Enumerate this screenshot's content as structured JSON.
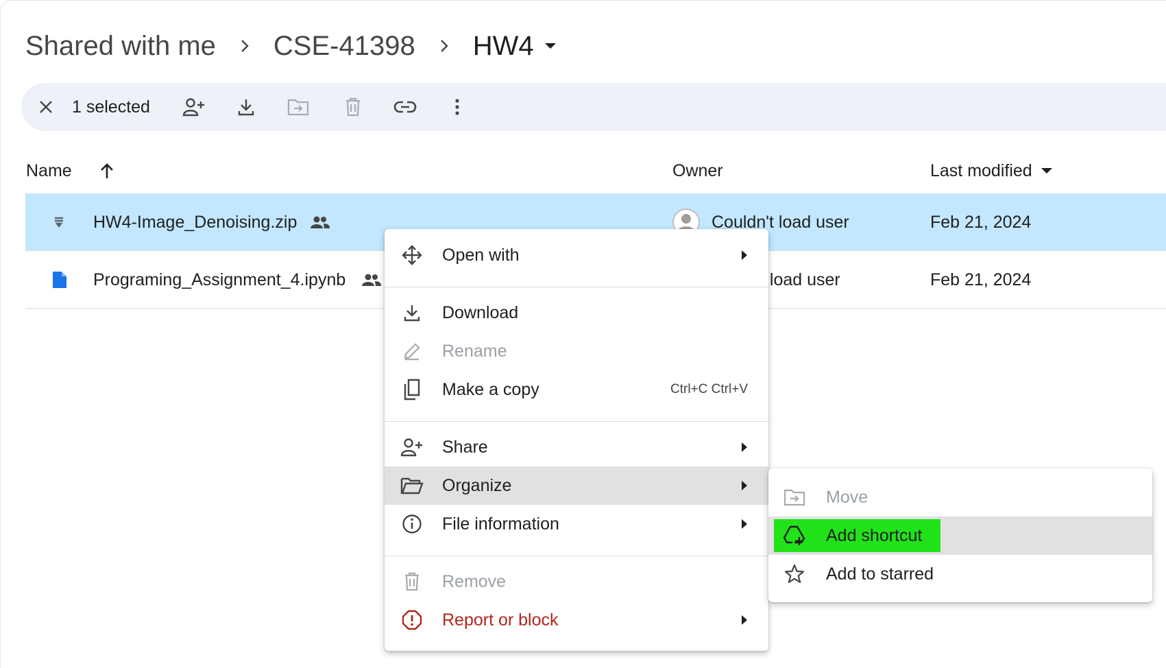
{
  "breadcrumb": {
    "items": [
      "Shared with me",
      "CSE-41398",
      "HW4"
    ]
  },
  "toolbar": {
    "selected_count": "1 selected",
    "icons": [
      "close-icon",
      "add-person-icon",
      "download-icon",
      "move-icon",
      "trash-icon",
      "link-icon",
      "more-vert-icon"
    ]
  },
  "table": {
    "headers": {
      "name": "Name",
      "owner": "Owner",
      "last_modified": "Last modified"
    },
    "sort": {
      "name": "ascending",
      "last_modified": "dropdown"
    },
    "rows": [
      {
        "name": "HW4-Image_Denoising.zip",
        "owner": "Couldn't load user",
        "modified": "Feb 21, 2024",
        "icon": "zip-icon",
        "shared": true,
        "selected": true
      },
      {
        "name": "Programing_Assignment_4.ipynb",
        "owner": "t load user",
        "modified": "Feb 21, 2024",
        "icon": "doc-icon",
        "shared": true,
        "selected": false
      }
    ]
  },
  "context_menu": {
    "open_with": "Open with",
    "download": "Download",
    "rename": "Rename",
    "make_copy": "Make a copy",
    "make_copy_shortcut": "Ctrl+C Ctrl+V",
    "share": "Share",
    "organize": "Organize",
    "file_information": "File information",
    "remove": "Remove",
    "report_or_block": "Report or block"
  },
  "submenu": {
    "move": "Move",
    "add_shortcut": "Add shortcut",
    "add_to_starred": "Add to starred"
  },
  "colors": {
    "selected_row": "#c2e7ff",
    "toolbar_bg": "#eef2f8",
    "danger": "#b3261e",
    "highlight": "#22e21a",
    "doc_blue": "#1a73e8"
  }
}
